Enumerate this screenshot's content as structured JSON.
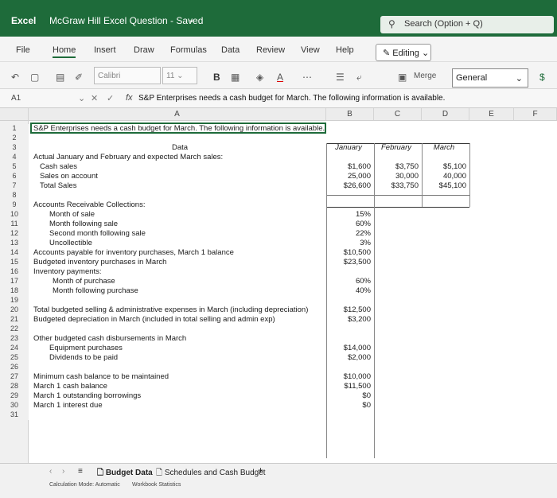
{
  "titlebar": {
    "app_name": "Excel",
    "doc_title": "McGraw Hill Excel Question - Saved",
    "search_placeholder": "Search (Option + Q)"
  },
  "ribbon_tabs": [
    "File",
    "Home",
    "Insert",
    "Draw",
    "Formulas",
    "Data",
    "Review",
    "View",
    "Help"
  ],
  "active_tab": "Home",
  "editing_label": "Editing",
  "toolbar": {
    "font_name": "Calibri",
    "font_size": "11",
    "bold_label": "B",
    "merge_label": "Merge",
    "number_format": "General",
    "currency_label": "$"
  },
  "formula_bar": {
    "cell_ref": "A1",
    "fx_label": "fx",
    "content": "S&P Enterprises needs a cash budget for March. The following information is available."
  },
  "columns": [
    "A",
    "B",
    "C",
    "D",
    "E",
    "F"
  ],
  "rows": [
    {
      "n": "1",
      "a": "S&P Enterprises needs a cash budget for March. The following information is available.",
      "b": "",
      "c": "",
      "d": ""
    },
    {
      "n": "2",
      "a": "",
      "b": "",
      "c": "",
      "d": ""
    },
    {
      "n": "3",
      "a": "Data",
      "b": "January",
      "c": "February",
      "d": "March"
    },
    {
      "n": "4",
      "a": "Actual January and February and expected March sales:",
      "b": "",
      "c": "",
      "d": ""
    },
    {
      "n": "5",
      "a": "Cash sales",
      "b": "$1,600",
      "c": "$3,750",
      "d": "$5,100"
    },
    {
      "n": "6",
      "a": "Sales on account",
      "b": "25,000",
      "c": "30,000",
      "d": "40,000"
    },
    {
      "n": "7",
      "a": "Total Sales",
      "b": "$26,600",
      "c": "$33,750",
      "d": "$45,100"
    },
    {
      "n": "8",
      "a": "",
      "b": "",
      "c": "",
      "d": ""
    },
    {
      "n": "9",
      "a": "Accounts Receivable Collections:",
      "b": "",
      "c": "",
      "d": ""
    },
    {
      "n": "10",
      "a": "Month of sale",
      "b": "15%",
      "c": "",
      "d": ""
    },
    {
      "n": "11",
      "a": "Month following sale",
      "b": "60%",
      "c": "",
      "d": ""
    },
    {
      "n": "12",
      "a": "Second month following sale",
      "b": "22%",
      "c": "",
      "d": ""
    },
    {
      "n": "13",
      "a": "Uncollectible",
      "b": "3%",
      "c": "",
      "d": ""
    },
    {
      "n": "14",
      "a": "Accounts payable for inventory purchases, March 1 balance",
      "b": "$10,500",
      "c": "",
      "d": ""
    },
    {
      "n": "15",
      "a": "Budgeted inventory purchases in March",
      "b": "$23,500",
      "c": "",
      "d": ""
    },
    {
      "n": "16",
      "a": "Inventory payments:",
      "b": "",
      "c": "",
      "d": ""
    },
    {
      "n": "17",
      "a": "Month of purchase",
      "b": "60%",
      "c": "",
      "d": ""
    },
    {
      "n": "18",
      "a": "Month following purchase",
      "b": "40%",
      "c": "",
      "d": ""
    },
    {
      "n": "19",
      "a": "",
      "b": "",
      "c": "",
      "d": ""
    },
    {
      "n": "20",
      "a": "Total budgeted selling & administrative expenses in March (including depreciation)",
      "b": "$12,500",
      "c": "",
      "d": ""
    },
    {
      "n": "21",
      "a": "Budgeted depreciation in March (included in total selling and admin exp)",
      "b": "$3,200",
      "c": "",
      "d": ""
    },
    {
      "n": "22",
      "a": "",
      "b": "",
      "c": "",
      "d": ""
    },
    {
      "n": "23",
      "a": "Other budgeted cash disbursements in March",
      "b": "",
      "c": "",
      "d": ""
    },
    {
      "n": "24",
      "a": "Equipment purchases",
      "b": "$14,000",
      "c": "",
      "d": ""
    },
    {
      "n": "25",
      "a": "Dividends to be paid",
      "b": "$2,000",
      "c": "",
      "d": ""
    },
    {
      "n": "26",
      "a": "",
      "b": "",
      "c": "",
      "d": ""
    },
    {
      "n": "27",
      "a": "Minimum cash balance to be maintained",
      "b": "$10,000",
      "c": "",
      "d": ""
    },
    {
      "n": "28",
      "a": "March 1 cash balance",
      "b": "$11,500",
      "c": "",
      "d": ""
    },
    {
      "n": "29",
      "a": "March 1 outstanding borrowings",
      "b": "$0",
      "c": "",
      "d": ""
    },
    {
      "n": "30",
      "a": "March 1 interest due",
      "b": "$0",
      "c": "",
      "d": ""
    },
    {
      "n": "31",
      "a": "",
      "b": "",
      "c": "",
      "d": ""
    }
  ],
  "sheet_tabs": [
    "Budget Data",
    "Schedules and Cash Budget"
  ],
  "add_sheet_label": "+",
  "status": {
    "calc_mode": "Calculation Mode: Automatic",
    "stats": "Workbook Statistics"
  }
}
